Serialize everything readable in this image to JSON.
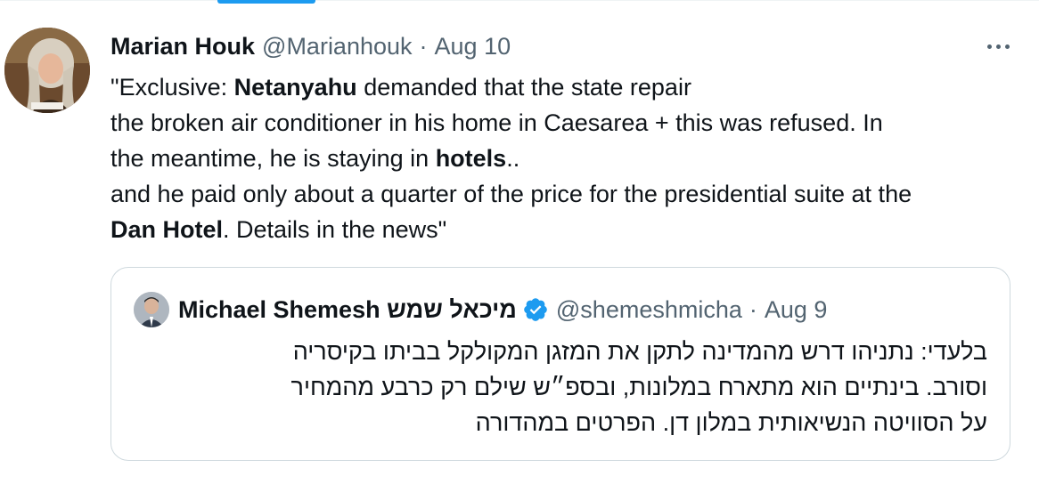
{
  "tweet": {
    "author_name": "Marian Houk",
    "author_handle": "@Marianhouk",
    "separator": "·",
    "date": "Aug 10",
    "text_lines": [
      [
        "\"Exclusive: ",
        "Netanyahu",
        " demanded that the state repair"
      ],
      [
        "the broken air conditioner in his home in Caesarea + this was refused. In"
      ],
      [
        "the meantime, he is staying in ",
        "hotels",
        ".."
      ],
      [
        "and he paid only about a quarter of the price for the presidential suite at the"
      ],
      [
        "",
        "Dan Hotel",
        ". Details in the news\""
      ]
    ]
  },
  "quoted_tweet": {
    "author_name": "Michael Shemesh מיכאל שמש",
    "author_handle": "@shemeshmicha",
    "separator": "·",
    "date": "Aug 9",
    "text_lines": [
      "בלעדי: נתניהו דרש מהמדינה לתקן את המזגן המקולקל בביתו בקיסריה",
      "וסורב. בינתיים הוא מתארח במלונות, ובספ״ש שילם רק כרבע מהמחיר",
      "על הסוויטה הנשיאותית במלון דן. הפרטים במהדורה"
    ]
  },
  "icons": {
    "more": "more-horizontal-icon",
    "verified": "verified-badge-icon"
  },
  "colors": {
    "accent": "#1d9bf0",
    "text_primary": "#0f1419",
    "text_secondary": "#536471",
    "border": "#cfd9de"
  }
}
